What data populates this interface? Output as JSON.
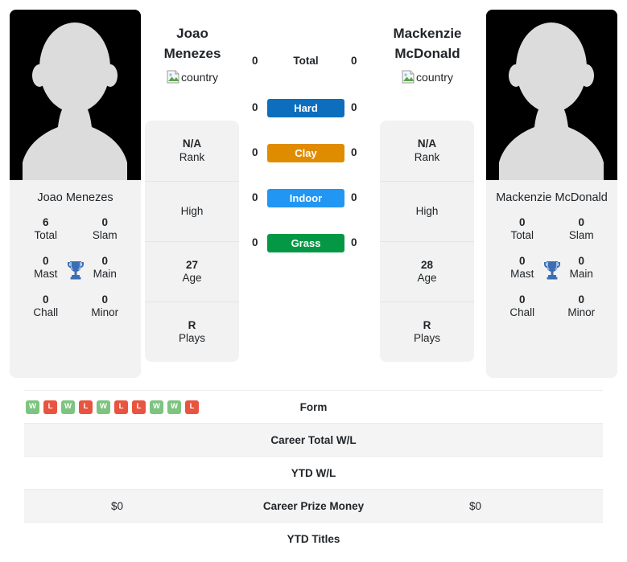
{
  "players": {
    "left": {
      "first_name": "Joao",
      "last_name": "Menezes",
      "full_name": "Joao Menezes",
      "country_alt": "country",
      "titles": {
        "total_value": "6",
        "total_label": "Total",
        "slam_value": "0",
        "slam_label": "Slam",
        "mast_value": "0",
        "mast_label": "Mast",
        "main_value": "0",
        "main_label": "Main",
        "chall_value": "0",
        "chall_label": "Chall",
        "minor_value": "0",
        "minor_label": "Minor"
      },
      "info": {
        "rank_value": "N/A",
        "rank_label": "Rank",
        "high_value": "",
        "high_label": "High",
        "age_value": "27",
        "age_label": "Age",
        "plays_value": "R",
        "plays_label": "Plays"
      },
      "surfaces": {
        "total": "0",
        "hard": "0",
        "clay": "0",
        "indoor": "0",
        "grass": "0"
      },
      "form": [
        "W",
        "L",
        "W",
        "L",
        "W",
        "L",
        "L",
        "W",
        "W",
        "L"
      ],
      "career_total_wl": "",
      "ytd_wl": "",
      "career_prize_money": "$0",
      "ytd_titles": ""
    },
    "right": {
      "first_name": "Mackenzie",
      "last_name": "McDonald",
      "full_name": "Mackenzie McDonald",
      "country_alt": "country",
      "titles": {
        "total_value": "0",
        "total_label": "Total",
        "slam_value": "0",
        "slam_label": "Slam",
        "mast_value": "0",
        "mast_label": "Mast",
        "main_value": "0",
        "main_label": "Main",
        "chall_value": "0",
        "chall_label": "Chall",
        "minor_value": "0",
        "minor_label": "Minor"
      },
      "info": {
        "rank_value": "N/A",
        "rank_label": "Rank",
        "high_value": "",
        "high_label": "High",
        "age_value": "28",
        "age_label": "Age",
        "plays_value": "R",
        "plays_label": "Plays"
      },
      "surfaces": {
        "total": "0",
        "hard": "0",
        "clay": "0",
        "indoor": "0",
        "grass": "0"
      },
      "form": [],
      "career_total_wl": "",
      "ytd_wl": "",
      "career_prize_money": "$0",
      "ytd_titles": ""
    }
  },
  "surface_labels": {
    "total": "Total",
    "hard": "Hard",
    "clay": "Clay",
    "indoor": "Indoor",
    "grass": "Grass"
  },
  "stats_rows": {
    "form": "Form",
    "career_total_wl": "Career Total W/L",
    "ytd_wl": "YTD W/L",
    "career_prize_money": "Career Prize Money",
    "ytd_titles": "YTD Titles"
  },
  "colors": {
    "hard": "#0d6ebd",
    "clay": "#e08c00",
    "indoor": "#2196f3",
    "grass": "#049845",
    "win": "#7cc47f",
    "loss": "#e8543f",
    "card_bg": "#f2f2f2",
    "row_stripe": "#f4f4f4",
    "text": "#212529",
    "trophy": "#3b6fb5"
  }
}
